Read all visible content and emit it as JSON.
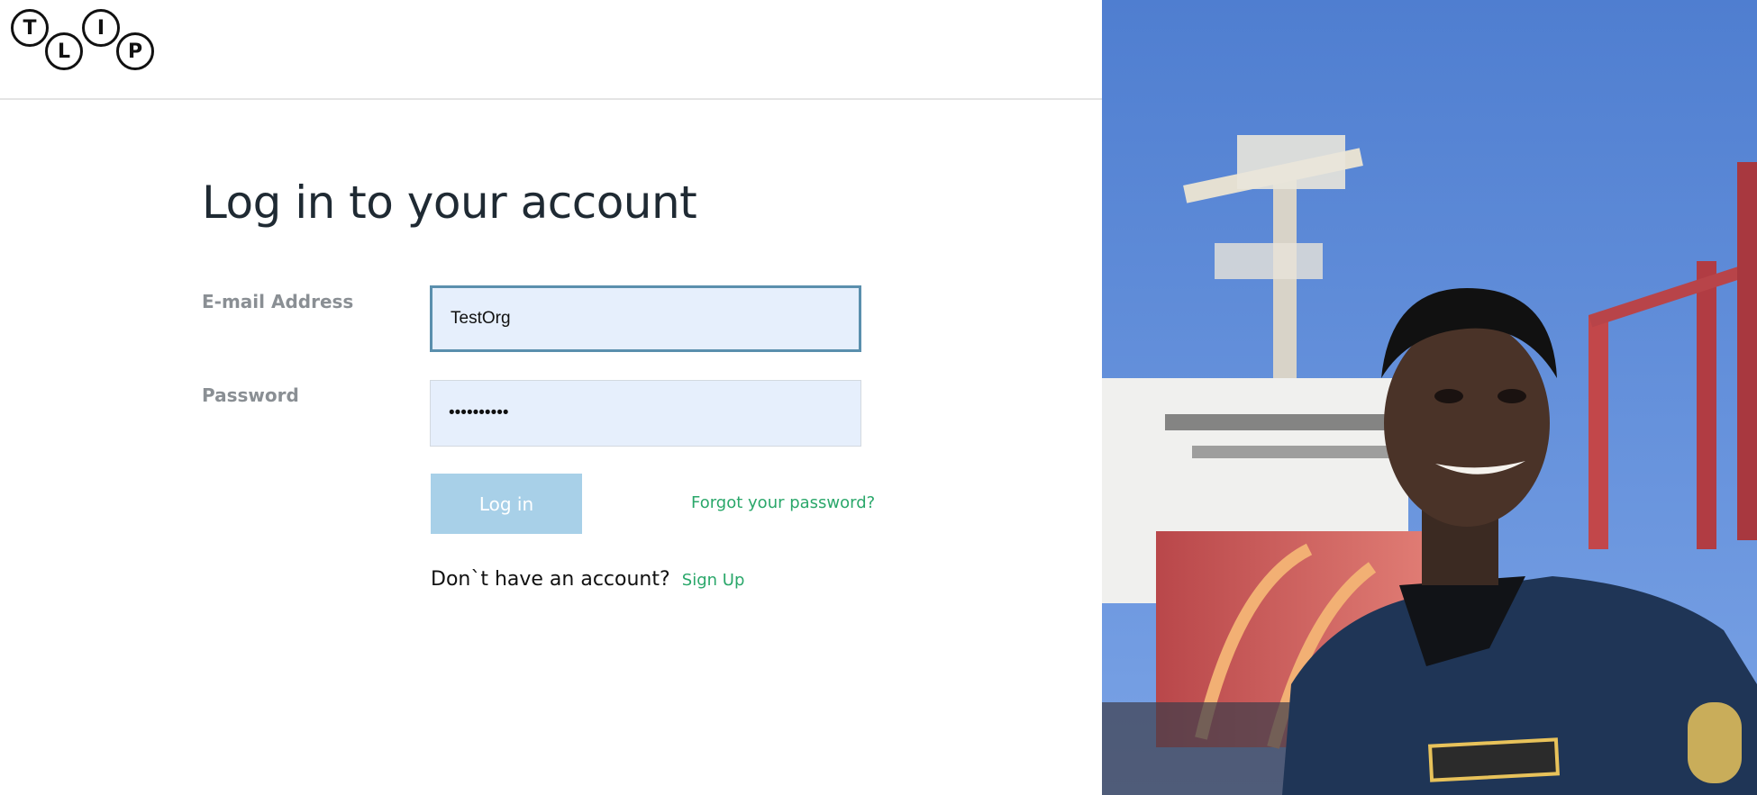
{
  "logo": {
    "letters": [
      "T",
      "L",
      "I",
      "P"
    ]
  },
  "login": {
    "title": "Log in to your account",
    "email_label": "E-mail Address",
    "email_value": "TestOrg",
    "password_label": "Password",
    "password_value": "••••••••••",
    "login_button": "Log in",
    "forgot_link": "Forgot your password?",
    "no_account_text": "Don`t have an account?",
    "signup_link": "Sign Up"
  },
  "colors": {
    "accent_green": "#2aa76a",
    "button_blue": "#a8d0e8",
    "input_bg": "#e6effc",
    "focus_border": "#5a8fad"
  }
}
